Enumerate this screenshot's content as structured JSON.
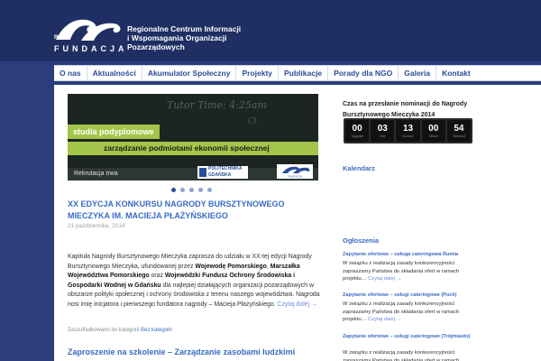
{
  "header": {
    "logo_rc": "RC",
    "logo_text": "FUNDACJA",
    "org_name": [
      "Regionalne Centrum Informacji",
      "i Wspomagania Organizacji",
      "Pozarządowych"
    ]
  },
  "nav": {
    "items": [
      "O nas",
      "Aktualności",
      "Akumulator Społeczny",
      "Projekty",
      "Publikacje",
      "Porady dla NGO",
      "Galeria",
      "Kontakt"
    ]
  },
  "slider": {
    "board_text": "Tutor  Time:  4:25am",
    "board_text2": "Cl.",
    "line1": "studia podyplomowe",
    "line2": "zarządzanie podmiotami ekonomii społecznej",
    "caption": "Rekrutacja trwa",
    "logo_pg": [
      "POLITECHNIKA",
      "GDAŃSKA"
    ],
    "logo_f": "FUNDACJA"
  },
  "post": {
    "title": "XX Edycja Konkursu Nagrody Bursztynowego Mieczyka im. Macieja Płażyńskiego",
    "date": "21 października, 2014",
    "body_1": "Kapituła Nagrody Bursztynowego Mieczyka zaprasza do udziału w XX-tej edycji Nagrody Bursztynowego Mieczyka, ufundowanej przez ",
    "body_b1": "Wojewodę Pomorskiego",
    "body_2": ", ",
    "body_b2": "Marszałka Województwa Pomorskiego",
    "body_3": " oraz ",
    "body_b3": "Wojewódzki Fundusz Ochrony Środowiska i Gospodarki Wodnej w Gdańsku",
    "body_4": " dla najlepiej działających organizacji pozarządowych w obszarze polityki społecznej i ochrony środowiska z terenu naszego województwa. Nagroda nosi imię inicjatora i pierwszego fundatora nagrody – Macieja Płażyńskiego.",
    "readmore": "Czytaj dalej →",
    "meta_prefix": "Zaszufladkowano do kategorii ",
    "meta_cat": "Bez kategorii"
  },
  "post2": {
    "title": "Zaproszenie na szkolenie – Zarządzanie zasobami ludzkimi"
  },
  "sidebar": {
    "countdown_title": "Czas na przesłanie nominacji do Nagrody Bursztynowego Mieczyka 2014",
    "countdown": [
      {
        "num": "00",
        "label": "Tygodni"
      },
      {
        "num": "03",
        "label": "Dni"
      },
      {
        "num": "13",
        "label": "Godzin"
      },
      {
        "num": "00",
        "label": "Minut"
      },
      {
        "num": "54",
        "label": "Sekund"
      }
    ],
    "calendar_heading": "Kalendarz",
    "ads_heading": "Ogłoszenia",
    "ads": [
      {
        "title": "Zapytanie ofertowe – usługa cateringowa Rumia",
        "body": "W związku z realizacją zasady konkurencyjności zapraszamy Państwa do składania ofert w ramach projektu…",
        "more": "Czytaj dalej →"
      },
      {
        "title": "Zapytanie ofertowe – usługi cateringowe (Puck)",
        "body": "W związku z realizacją zasady konkurencyjności zapraszamy Państwa do składania ofert w ramach projektu…",
        "more": "Czytaj dalej →"
      },
      {
        "title": "Zapytanie ofertowe – usługi cateringowe (Trójmiasto)",
        "body": "W związku z realizacją zasady konkurencyjności zapraszamy Państwa do składania ofert w ramach",
        "more": ""
      }
    ]
  }
}
